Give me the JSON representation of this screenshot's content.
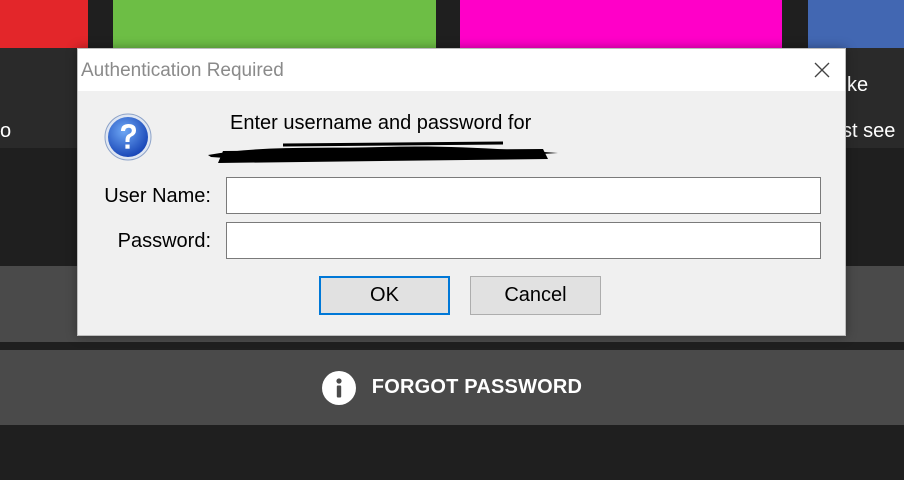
{
  "background": {
    "side_text_1": "ke",
    "side_text_2": "st see",
    "side_text_left": "o",
    "forgot_password": "FORGOT PASSWORD"
  },
  "dialog": {
    "title": "Authentication Required",
    "prompt": "Enter username and password for",
    "username_label": "User Name:",
    "username_value": "",
    "password_label": "Password:",
    "password_value": "",
    "ok_label": "OK",
    "cancel_label": "Cancel"
  },
  "colors": {
    "ok_focus": "#0078d7",
    "forgot_bar": "#4a4a4a"
  }
}
